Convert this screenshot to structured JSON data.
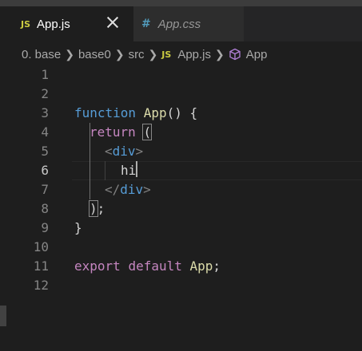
{
  "tabs": [
    {
      "icon": "JS",
      "label": "App.js",
      "active": true
    },
    {
      "icon": "#",
      "label": "App.css",
      "active": false
    }
  ],
  "breadcrumb": [
    "0. base",
    "base0",
    "src",
    "App.js",
    "App"
  ],
  "breadcrumb_icons": {
    "file": "JS",
    "symbol": "cube-icon"
  },
  "line_numbers": [
    "1",
    "2",
    "3",
    "4",
    "5",
    "6",
    "7",
    "8",
    "9",
    "10",
    "11",
    "12"
  ],
  "active_line": "6",
  "code": {
    "l3_kw": "function",
    "l3_fn": "App",
    "l3_rest": "() {",
    "l4_kw": "return",
    "l4_paren": "(",
    "l5_open": "<",
    "l5_tag": "div",
    "l5_close": ">",
    "l6_text": "hi",
    "l7_open": "</",
    "l7_tag": "div",
    "l7_close": ">",
    "l8_paren": ")",
    "l8_rest": ";",
    "l9": "}",
    "l11_kw1": "export",
    "l11_kw2": "default",
    "l11_fn": "App",
    "l11_rest": ";"
  },
  "colors": {
    "editor_bg": "#1e1e1e",
    "keyword": "#569cd6",
    "function": "#dcdcaa",
    "control": "#c586c0",
    "js_icon": "#cbcb41",
    "css_icon": "#519aba"
  }
}
